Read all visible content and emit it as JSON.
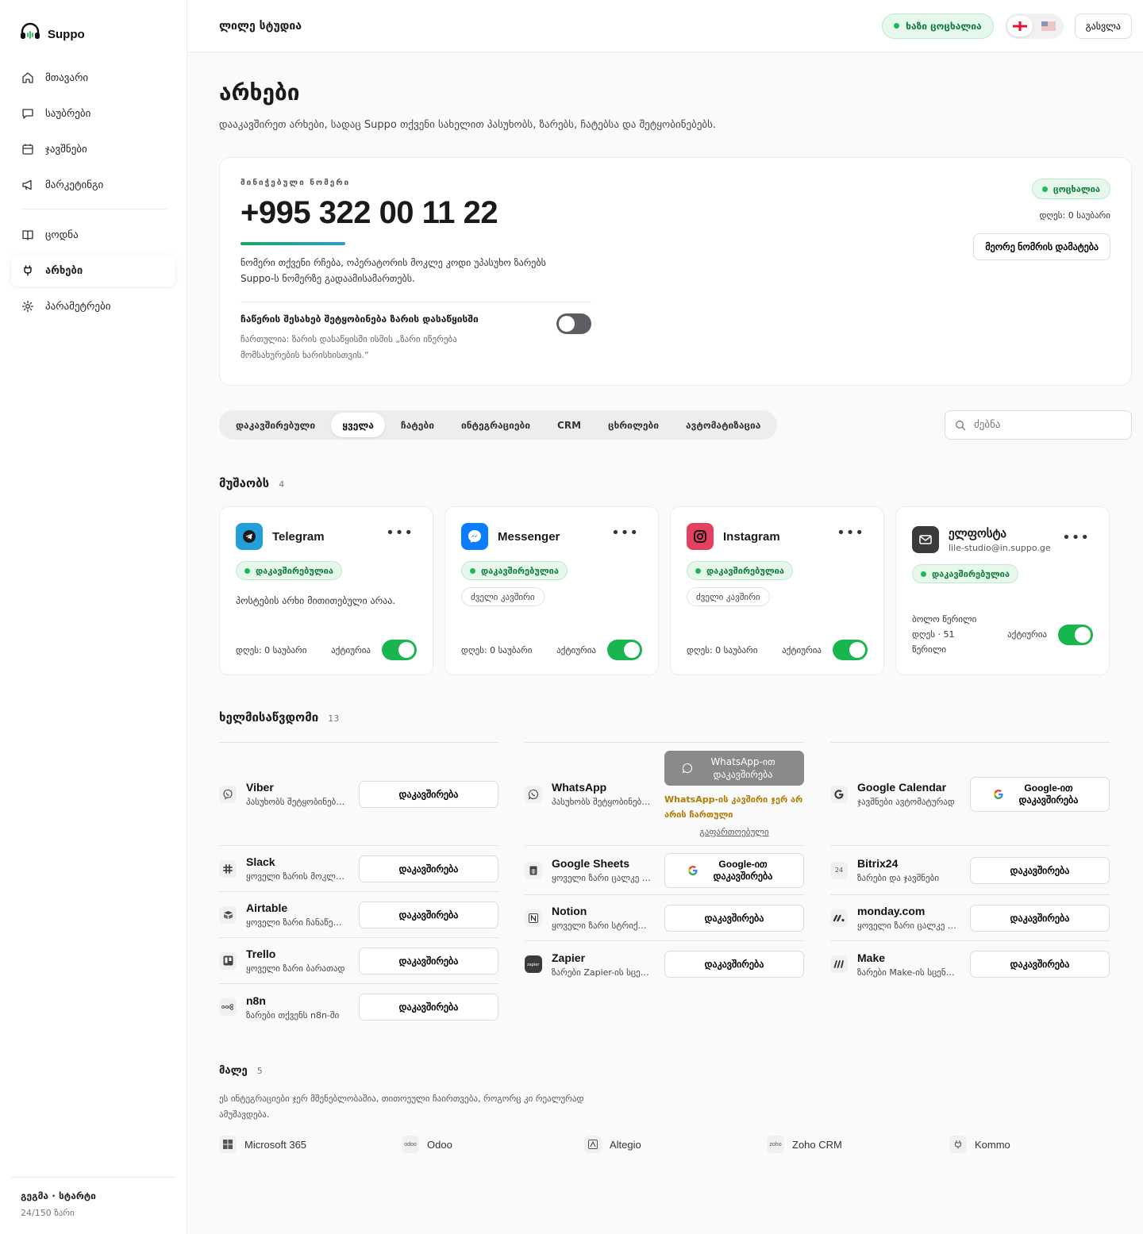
{
  "brand": {
    "name": "Suppo",
    "accent": "#1db954"
  },
  "sidebar": {
    "items": [
      {
        "label": "მთავარი",
        "icon": "home-icon"
      },
      {
        "label": "საუბრები",
        "icon": "chat-icon"
      },
      {
        "label": "ჯავშნები",
        "icon": "calendar-icon"
      },
      {
        "label": "მარკეტინგი",
        "icon": "megaphone-icon"
      },
      {
        "label": "ცოდნა",
        "icon": "book-icon"
      },
      {
        "label": "არხები",
        "icon": "plug-icon",
        "active": true
      },
      {
        "label": "პარამეტრები",
        "icon": "gear-icon"
      }
    ],
    "plan": {
      "name": "გეგმა · სტარტი",
      "usage": "24/150 ზარი"
    }
  },
  "topbar": {
    "workspace": "ლილე სტუდია",
    "live_label": "ხაზი ცოცხალია",
    "languages": [
      "ka",
      "en"
    ],
    "logout_label": "გასვლა"
  },
  "page": {
    "title": "არხები",
    "subtitle": "დააკავშირეთ არხები, სადაც Suppo თქვენი სახელით პასუხობს, ზარებს, ჩატებსა და შეტყობინებებს."
  },
  "number_card": {
    "label": "მინიჭებული ნომერი",
    "number": "+995 322 00 11 22",
    "description": "ნომერი თქვენი რჩება, ოპერატორის მოკლე კოდი უპასუხო ზარებს Suppo-ს ნომერზე გადაამისამართებს.",
    "recording_title": "ჩაწერის შესახებ შეტყობინება ზარის დასაწყისში",
    "recording_desc": "ჩართულია: ზარის დასაწყისში ისმის „ზარი იწერება მომსახურების ხარისხისთვის.“",
    "recording_on": false,
    "status": "ცოცხალია",
    "today": "დღეს: 0 საუბარი",
    "add_button": "მეორე ნომრის დამატება"
  },
  "filters": {
    "tabs": [
      "დაკავშირებული",
      "ყველა",
      "ჩატები",
      "ინტეგრაციები",
      "CRM",
      "ცხრილები",
      "ავტომატიზაცია"
    ],
    "active": "ყველა",
    "search_placeholder": "ძებნა"
  },
  "working": {
    "title": "მუშაობს",
    "count": "4",
    "cards": [
      {
        "name": "Telegram",
        "icon": "telegram-icon",
        "color": "#229ed9",
        "badge": "დაკავშირებულია",
        "note": "პოსტების არხი მითითებული არაა.",
        "today": "დღეს: 0 საუბარი",
        "active_label": "აქტიურია",
        "active": true
      },
      {
        "name": "Messenger",
        "icon": "messenger-icon",
        "color": "#0a7cff",
        "badge": "დაკავშირებულია",
        "legacy": "ძველი კავშირი",
        "today": "დღეს: 0 საუბარი",
        "active_label": "აქტიურია",
        "active": true
      },
      {
        "name": "Instagram",
        "icon": "instagram-icon",
        "color": "#e4405f",
        "badge": "დაკავშირებულია",
        "legacy": "ძველი კავშირი",
        "today": "დღეს: 0 საუბარი",
        "active_label": "აქტიურია",
        "active": true
      },
      {
        "name": "ელფოსტა",
        "sub": "lile-studio@in.suppo.ge",
        "icon": "mail-icon",
        "color": "#3a3a3a",
        "badge": "დაკავშირებულია",
        "today": "ბოლო წერილი დღეს · 51 წერილი",
        "active_label": "აქტიურია",
        "active": true
      }
    ]
  },
  "available": {
    "title": "ხელმისაწვდომი",
    "count": "13",
    "connect_label": "დაკავშირება",
    "google_label": "Google-ით დაკავშირება",
    "columns": [
      [
        {
          "name": "Viber",
          "desc": "პასუხობს შეტყობინებებს",
          "icon": "viber-icon"
        },
        {
          "name": "Slack",
          "desc": "ყოველი ზარის მოკლე შეჯამება",
          "icon": "slack-icon"
        },
        {
          "name": "Airtable",
          "desc": "ყოველი ზარი ჩანაწერად",
          "icon": "airtable-icon"
        },
        {
          "name": "Trello",
          "desc": "ყოველი ზარი ბარათად",
          "icon": "trello-icon"
        },
        {
          "name": "n8n",
          "desc": "ზარები თქვენს n8n-ში",
          "icon": "n8n-icon"
        }
      ],
      [
        {
          "name": "WhatsApp",
          "desc": "პასუხობს შეტყობინებებს",
          "icon": "whatsapp-icon",
          "special": "whatsapp"
        },
        {
          "name": "Google Sheets",
          "desc": "ყოველი ზარი ცალკე სტრიქონად",
          "icon": "sheets-icon",
          "google": true
        },
        {
          "name": "Notion",
          "desc": "ყოველი ზარი სტრიქონად",
          "icon": "notion-icon"
        },
        {
          "name": "Zapier",
          "desc": "ზარები Zapier-ის სცენარებში",
          "icon": "zapier-icon"
        }
      ],
      [
        {
          "name": "Google Calendar",
          "desc": "ჯავშნები ავტომატურად",
          "icon": "google-icon",
          "google": true
        },
        {
          "name": "Bitrix24",
          "desc": "ზარები და ჯავშნები",
          "icon": "bitrix-icon"
        },
        {
          "name": "monday.com",
          "desc": "ყოველი ზარი ცალკე ელემენტად",
          "icon": "monday-icon"
        },
        {
          "name": "Make",
          "desc": "ზარები Make-ის სცენარებში",
          "icon": "make-icon"
        }
      ]
    ],
    "whatsapp": {
      "button": "WhatsApp-ით დაკავშირება",
      "warning": "WhatsApp-ის კავშირი ჯერ არ არის ჩართული",
      "advanced": "გაფართოებული"
    }
  },
  "soon": {
    "title": "მალე",
    "count": "5",
    "desc": "ეს ინტეგრაციები ჯერ მშენებლობაშია, თითოეული ჩაირთვება, როგორც კი რეალურად ამუშავდება.",
    "items": [
      {
        "name": "Microsoft 365",
        "icon": "microsoft-icon"
      },
      {
        "name": "Odoo",
        "icon": "odoo-icon"
      },
      {
        "name": "Altegio",
        "icon": "altegio-icon"
      },
      {
        "name": "Zoho CRM",
        "icon": "zoho-icon"
      },
      {
        "name": "Kommo",
        "icon": "kommo-icon"
      }
    ]
  }
}
